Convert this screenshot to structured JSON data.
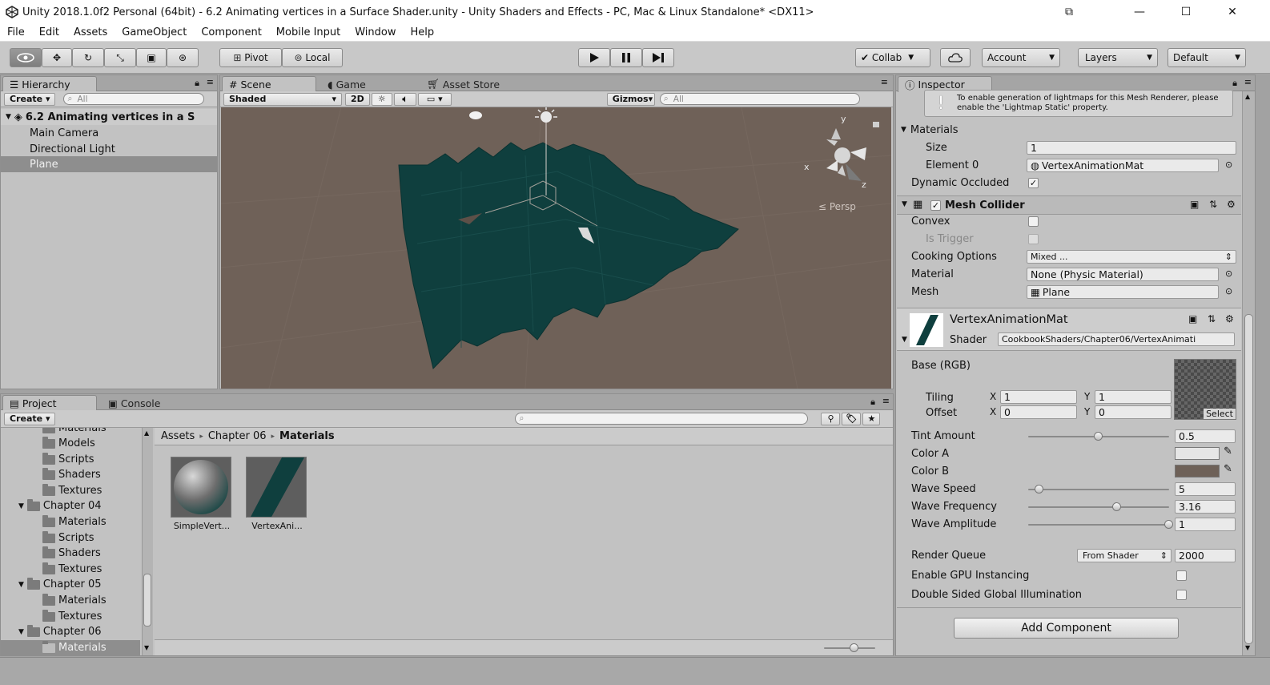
{
  "window": {
    "title": "Unity 2018.1.0f2 Personal (64bit) - 6.2 Animating vertices in a Surface Shader.unity - Unity Shaders and Effects - PC, Mac & Linux Standalone* <DX11>"
  },
  "menu": [
    "File",
    "Edit",
    "Assets",
    "GameObject",
    "Component",
    "Mobile Input",
    "Window",
    "Help"
  ],
  "toolbar": {
    "pivot": "Pivot",
    "local": "Local",
    "collab": "Collab",
    "account": "Account",
    "layers": "Layers",
    "layout": "Default"
  },
  "hierarchy": {
    "tab": "Hierarchy",
    "create": "Create",
    "search_placeholder": "All",
    "scene_name": "6.2 Animating vertices in a S",
    "items": [
      "Main Camera",
      "Directional Light",
      "Plane"
    ]
  },
  "scene": {
    "tabs": [
      "Scene",
      "Game",
      "Asset Store"
    ],
    "shading": "Shaded",
    "mode_2d": "2D",
    "gizmos": "Gizmos",
    "search_placeholder": "All",
    "persp": "Persp",
    "axis_y": "y",
    "axis_x": "x",
    "axis_z": "z"
  },
  "project": {
    "tabs": [
      "Project",
      "Console"
    ],
    "create": "Create",
    "breadcrumb": [
      "Assets",
      "Chapter 06",
      "Materials"
    ],
    "tree": [
      {
        "label": "Materials",
        "indent": 2
      },
      {
        "label": "Models",
        "indent": 2
      },
      {
        "label": "Scripts",
        "indent": 2
      },
      {
        "label": "Shaders",
        "indent": 2
      },
      {
        "label": "Textures",
        "indent": 2
      },
      {
        "label": "Chapter 04",
        "indent": 1
      },
      {
        "label": "Materials",
        "indent": 2
      },
      {
        "label": "Scripts",
        "indent": 2
      },
      {
        "label": "Shaders",
        "indent": 2
      },
      {
        "label": "Textures",
        "indent": 2
      },
      {
        "label": "Chapter 05",
        "indent": 1
      },
      {
        "label": "Materials",
        "indent": 2
      },
      {
        "label": "Textures",
        "indent": 2
      },
      {
        "label": "Chapter 06",
        "indent": 1
      },
      {
        "label": "Materials",
        "indent": 2
      }
    ],
    "assets": [
      "SimpleVert...",
      "VertexAni..."
    ]
  },
  "inspector": {
    "tab": "Inspector",
    "warning": "To enable generation of lightmaps for this Mesh Renderer, please enable the 'Lightmap Static' property.",
    "materials_label": "Materials",
    "size_label": "Size",
    "size_value": "1",
    "element0_label": "Element 0",
    "element0_value": "VertexAnimationMat",
    "dynamic_occluded_label": "Dynamic Occluded",
    "mesh_collider": "Mesh Collider",
    "convex_label": "Convex",
    "is_trigger_label": "Is Trigger",
    "cooking_label": "Cooking Options",
    "cooking_value": "Mixed ...",
    "material_label": "Material",
    "material_value": "None (Physic Material)",
    "mesh_label": "Mesh",
    "mesh_value": "Plane",
    "mat_name": "VertexAnimationMat",
    "shader_label": "Shader",
    "shader_value": "CookbookShaders/Chapter06/VertexAnimati",
    "base_label": "Base (RGB)",
    "select": "Select",
    "tiling_label": "Tiling",
    "offset_label": "Offset",
    "x": "X",
    "y": "Y",
    "tiling_x": "1",
    "tiling_y": "1",
    "offset_x": "0",
    "offset_y": "0",
    "tint_label": "Tint Amount",
    "tint_value": "0.5",
    "tint_frac": 0.5,
    "color_a_label": "Color A",
    "color_a": "#e6e6e6",
    "color_b_label": "Color B",
    "color_b": "#6e6158",
    "wave_speed_label": "Wave Speed",
    "wave_speed_value": "5",
    "wave_speed_frac": 0.08,
    "wave_freq_label": "Wave Frequency",
    "wave_freq_value": "3.16",
    "wave_freq_frac": 0.63,
    "wave_amp_label": "Wave Amplitude",
    "wave_amp_value": "1",
    "wave_amp_frac": 1.0,
    "render_queue_label": "Render Queue",
    "render_queue_mode": "From Shader",
    "render_queue_value": "2000",
    "gpu_label": "Enable GPU Instancing",
    "dsgi_label": "Double Sided Global Illumination",
    "add_component": "Add Component"
  },
  "colors": {
    "plane": "#0f3f3e",
    "scene_bg": "#6f6158",
    "selection": "#8e8e8e"
  }
}
